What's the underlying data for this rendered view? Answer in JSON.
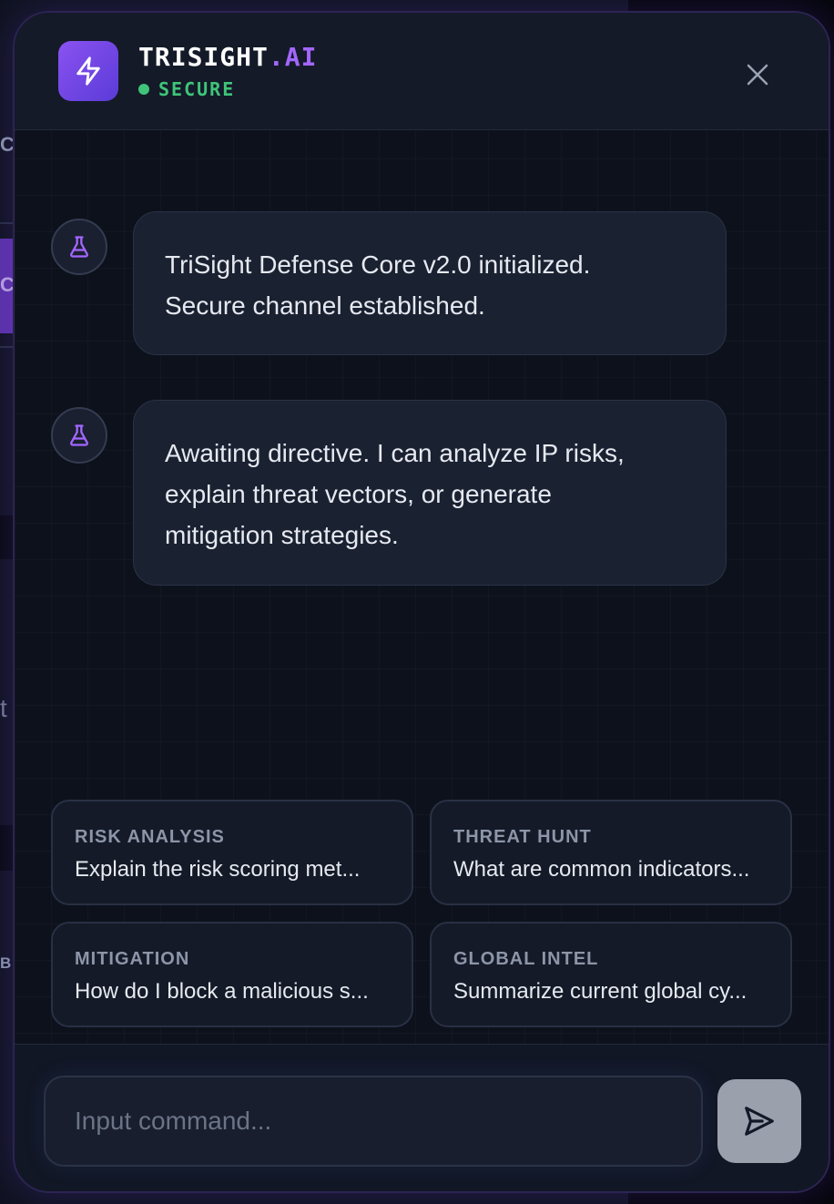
{
  "background": {
    "fragments": [
      "C",
      "C",
      "t",
      "B"
    ]
  },
  "header": {
    "brand_main": "TRISIGHT",
    "brand_suffix": ".AI",
    "status_label": "SECURE",
    "logo_icon": "lightning-icon",
    "close_icon": "close-icon"
  },
  "messages": [
    {
      "avatar_icon": "flask-icon",
      "lines": [
        "TriSight Defense Core v2.0 initialized.",
        "Secure channel established."
      ]
    },
    {
      "avatar_icon": "flask-icon",
      "lines": [
        "Awaiting directive. I can analyze IP risks,",
        "explain threat vectors, or generate",
        "mitigation strategies."
      ]
    }
  ],
  "suggestions": [
    {
      "category": "RISK ANALYSIS",
      "text": "Explain the risk scoring met..."
    },
    {
      "category": "THREAT HUNT",
      "text": "What are common indicators..."
    },
    {
      "category": "MITIGATION",
      "text": "How do I block a malicious s..."
    },
    {
      "category": "GLOBAL INTEL",
      "text": "Summarize current global cy..."
    }
  ],
  "composer": {
    "placeholder": "Input command...",
    "value": "",
    "send_icon": "send-icon"
  },
  "colors": {
    "accent": "#a366ff",
    "status": "#3fc47a",
    "panel_bg": "#0d111c",
    "bubble_bg": "#1a2131"
  }
}
